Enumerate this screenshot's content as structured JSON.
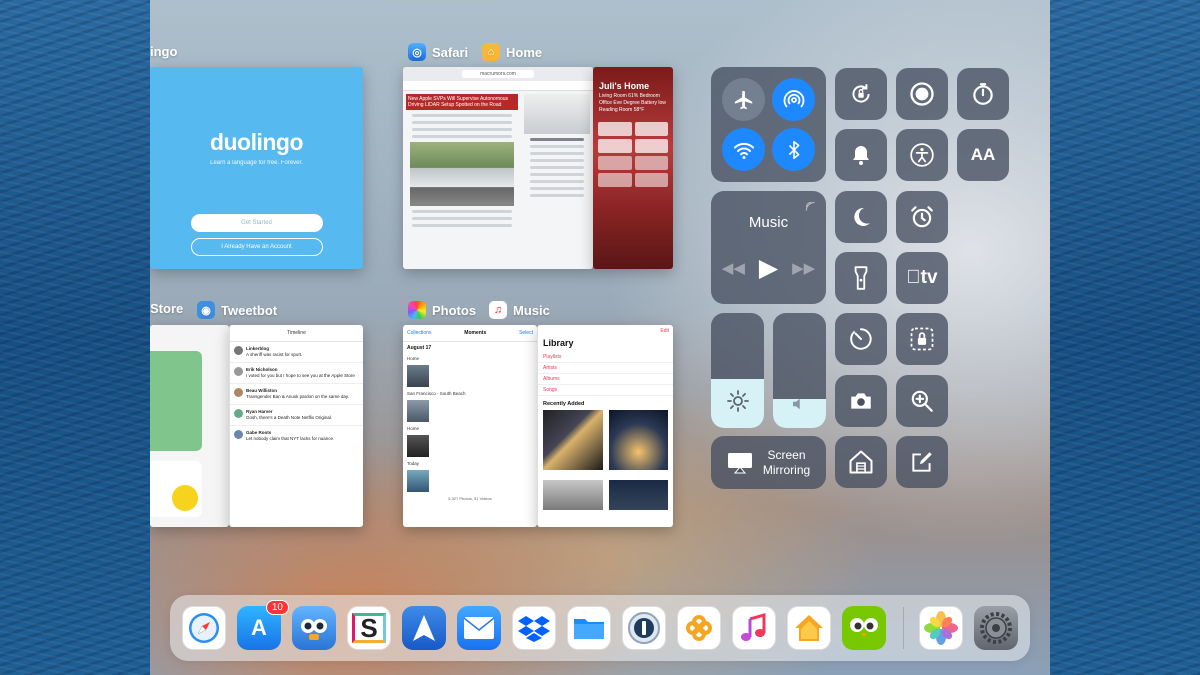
{
  "switcher": {
    "top_row": {
      "duolingo_label": "ingo",
      "safari_label": "Safari",
      "home_label": "Home"
    },
    "bottom_row": {
      "appstore_label": "Store",
      "tweetbot_label": "Tweetbot",
      "photos_label": "Photos",
      "music_label": "Music"
    }
  },
  "duolingo_card": {
    "logo": "duolingo",
    "tagline": "Learn a language for free. Forever.",
    "get_started": "Get Started",
    "have_account": "I Already Have an Account"
  },
  "safari_card": {
    "url": "macrumors.com",
    "headline": "New Apple SVPs Will Supervise Autonomous Driving LIDAR Setup Spotted on the Road"
  },
  "home_card": {
    "title": "Juli's Home",
    "subtitle": "Living Room 61% Bedroom Office Eve Degree Battery low Reading Room 58°F"
  },
  "tweetbot_card": {
    "header": "Timeline",
    "tweets": [
      {
        "user": "Linkerblog",
        "text": "A sheriff was racist for sport."
      },
      {
        "user": "Erik Nicholson",
        "text": "I voted for you but I hope to see you at the Apple Store"
      },
      {
        "user": "Beau Williston",
        "text": "Transgender Ban & Anusk pardon on the same day."
      },
      {
        "user": "Ryan Harver",
        "text": "Gosh, there's a Death Note Netflix Original."
      },
      {
        "user": "Gabe Roots",
        "text": "Let nobody claim that NYT lacks for nuance."
      }
    ]
  },
  "photos_card": {
    "back": "Collections",
    "header": "Moments",
    "select": "Select",
    "date": "August 17",
    "sections": [
      "Home",
      "San Francisco - South Beach",
      "Home",
      "Today"
    ],
    "footer": "5,327 Photos, 31 Videos"
  },
  "music_card": {
    "title": "Library",
    "items": [
      "Playlists",
      "Artists",
      "Albums",
      "Songs"
    ],
    "recent": "Recently Added",
    "edit": "Edit"
  },
  "control_center": {
    "music_title": "Music",
    "screen_mirroring": "Screen\nMirroring",
    "text_size": "AA",
    "brightness_level": 0.43,
    "volume_level": 0.25,
    "airplane_on": false,
    "airdrop_on": true,
    "wifi_on": true,
    "bluetooth_on": true,
    "accent_color": "#1e88ff"
  },
  "dock": {
    "apps": [
      {
        "name": "Safari",
        "icon": "compass-icon"
      },
      {
        "name": "App Store",
        "icon": "app-store-icon",
        "badge": "10"
      },
      {
        "name": "Tweetbot",
        "icon": "tweetbot-icon"
      },
      {
        "name": "Slack",
        "icon": "slack-icon"
      },
      {
        "name": "Spark",
        "icon": "spark-icon"
      },
      {
        "name": "Mail",
        "icon": "mail-icon"
      },
      {
        "name": "Dropbox",
        "icon": "dropbox-icon"
      },
      {
        "name": "Files",
        "icon": "folder-icon"
      },
      {
        "name": "1Password",
        "icon": "1password-icon"
      },
      {
        "name": "Workflow",
        "icon": "workflow-icon"
      },
      {
        "name": "Music",
        "icon": "music-note-icon"
      },
      {
        "name": "Home",
        "icon": "home-icon"
      },
      {
        "name": "Duolingo",
        "icon": "owl-icon"
      },
      {
        "name": "Photos",
        "icon": "photos-icon"
      },
      {
        "name": "Settings",
        "icon": "gear-icon"
      }
    ]
  }
}
